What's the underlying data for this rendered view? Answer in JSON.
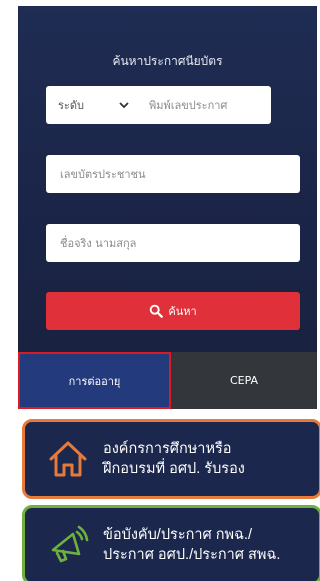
{
  "search": {
    "title": "ค้นหาประกาศนียบัตร",
    "level_select": "ระดับ",
    "notice_placeholder": "พิมพ์เลขประกาศ",
    "idcard_placeholder": "เลขบัตรประชาชน",
    "name_placeholder": "ชื่อจริง นามสกุล",
    "search_label": "ค้นหา",
    "search_icon": "search-icon"
  },
  "tabs": [
    {
      "label": "การต่ออายุ",
      "active": true
    },
    {
      "label": "CEPA",
      "active": false
    }
  ],
  "cards": [
    {
      "line1": "องค์กรการศึกษาหรือ",
      "line2": "ฝึกอบรมที่ อศป. รับรอง",
      "icon": "home-icon",
      "border": "#e67a3a"
    },
    {
      "line1": "ข้อบังคับ/ประกาศ กพฉ./",
      "line2": "ประกาศ อศป./ประกาศ สพฉ.",
      "icon": "megaphone-icon",
      "border": "#6fb13f"
    }
  ],
  "colors": {
    "panel": "#1f2c53",
    "search_button": "#e0313b",
    "active_tab": "#233a7c",
    "tab_bar": "#33373c",
    "highlight": "#d81c22"
  }
}
